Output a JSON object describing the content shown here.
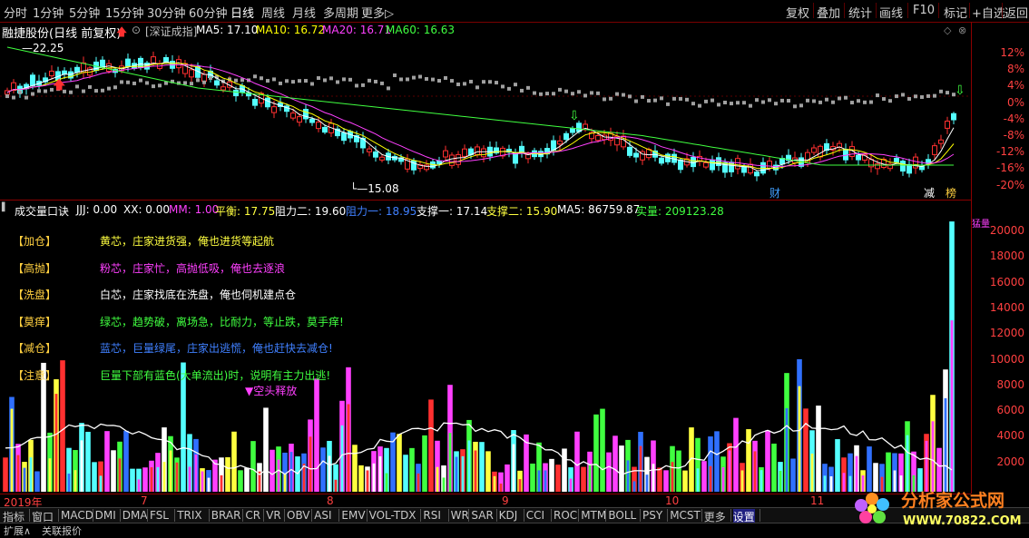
{
  "periods": [
    "分时",
    "1分钟",
    "5分钟",
    "15分钟",
    "30分钟",
    "60分钟",
    "日线",
    "周线",
    "月线",
    "多周期",
    "更多▷"
  ],
  "active_period": "日线",
  "toolbar_buttons": [
    "复权",
    "叠加",
    "统计",
    "画线",
    "F10",
    "标记",
    "+自选",
    "返回"
  ],
  "stock": {
    "name": "融捷股份(日线 前复权)",
    "index_label": "[深证成指]",
    "ma5": "MA5: 17.10",
    "ma10": "MA10: 16.72",
    "ma20": "MA20: 16.71",
    "ma60": "MA60: 16.63",
    "high_label": "22.25",
    "low_label": "15.08",
    "marks": [
      "财",
      "减",
      "榜"
    ]
  },
  "price_axis": [
    "12%",
    "8%",
    "4%",
    "0%",
    "-4%",
    "-8%",
    "-12%",
    "-16%",
    "-20%"
  ],
  "indicator": {
    "name": "成交量口诀",
    "jjj": "JJJ: 0.00",
    "xx": "XX: 0.00",
    "mm": "MM: 1.00",
    "pingheng": "平衡: 17.75",
    "zuli2": "阻力二: 19.60",
    "zuli1": "阻力一: 18.95",
    "zhicheng1": "支撑一: 17.14",
    "zhicheng2": "支撑二: 15.90",
    "ma5": "MA5: 86759.87",
    "shiliang": "实量: 209123.28",
    "annotation": "▼空头释放",
    "spike_label": "猛量"
  },
  "legend": [
    {
      "tag": "【加仓】",
      "text": "黄芯，庄家进货强，俺也进货等起航",
      "color": "#ffff40"
    },
    {
      "tag": "【高抛】",
      "text": "粉芯，庄家忙，高抛低吸，俺也去逐浪",
      "color": "#ff40ff"
    },
    {
      "tag": "【洗盘】",
      "text": "白芯，庄家找底在洗盘，俺也伺机建点仓",
      "color": "#ffffff"
    },
    {
      "tag": "【莫痒】",
      "text": "绿芯，趋势破，离场急，比耐力，等止跌，莫手痒!",
      "color": "#40ff40"
    },
    {
      "tag": "【减仓】",
      "text": "蓝芯，巨量绿尾，庄家出逃慌，俺也赶快去减仓!",
      "color": "#4080ff"
    },
    {
      "tag": "【注意】",
      "text": "巨量下部有蓝色(大单流出)时，说明有主力出逃!",
      "color": "#40ff40"
    }
  ],
  "volume_axis": [
    "20000",
    "18000",
    "16000",
    "14000",
    "12000",
    "10000",
    "8000",
    "6000",
    "4000",
    "2000"
  ],
  "dates": [
    "2019年",
    "7",
    "8",
    "9",
    "10",
    "11"
  ],
  "tabs": [
    "指标",
    "窗口",
    "MACD",
    "DMI",
    "DMA",
    "FSL",
    "TRIX",
    "BRAR",
    "CR",
    "VR",
    "OBV",
    "ASI",
    "EMV",
    "VOL-TDX",
    "RSI",
    "WR",
    "SAR",
    "KDJ",
    "CCI",
    "ROC",
    "MTM",
    "BOLL",
    "PSY",
    "MCST",
    "更多",
    "设置"
  ],
  "bottom_tabs": [
    "扩展∧",
    "关联报价"
  ],
  "watermark": {
    "cn": "分析家公式网",
    "url": "WWW.70822.COM"
  },
  "colors": {
    "up": "#ff3030",
    "down": "#54ffff",
    "ma5": "#ffffff",
    "ma10": "#ffff00",
    "ma20": "#ff40ff",
    "ma60": "#40ff40",
    "grid": "#8b0000"
  }
}
